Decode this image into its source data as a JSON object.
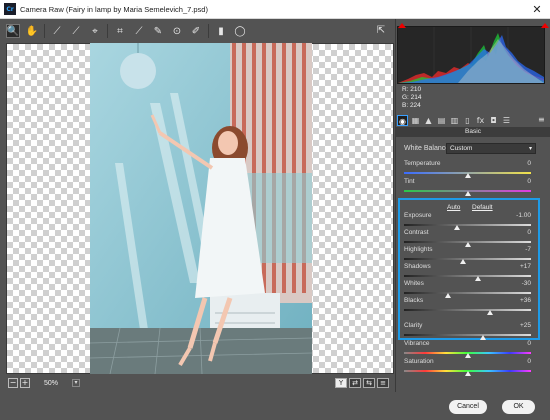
{
  "window": {
    "title": "Camera Raw (Fairy in lamp by Maria Semelevich_7.psd)",
    "app_badge": "Cr",
    "close_glyph": "✕"
  },
  "toolbar": {
    "tools": [
      {
        "name": "zoom-tool-icon",
        "glyph": "🔍"
      },
      {
        "name": "hand-tool-icon",
        "glyph": "✋"
      },
      {
        "name": "white-balance-tool-icon",
        "glyph": "⟋"
      },
      {
        "name": "color-sampler-tool-icon",
        "glyph": "⟋"
      },
      {
        "name": "targeted-adjustment-tool-icon",
        "glyph": "⌖"
      },
      {
        "name": "crop-tool-icon",
        "glyph": "⌗"
      },
      {
        "name": "straighten-tool-icon",
        "glyph": "⟋"
      },
      {
        "name": "spot-removal-tool-icon",
        "glyph": "✎"
      },
      {
        "name": "red-eye-tool-icon",
        "glyph": "⊙"
      },
      {
        "name": "adjustment-brush-icon",
        "glyph": "✐"
      },
      {
        "name": "graduated-filter-icon",
        "glyph": "▮"
      },
      {
        "name": "radial-filter-icon",
        "glyph": "◯"
      }
    ],
    "export_glyph": "⇱"
  },
  "status": {
    "zoom_minus": "−",
    "zoom_plus": "+",
    "zoom": "50%",
    "zoom_caret": "▾",
    "view_buttons": [
      "Y",
      "⇄",
      "⇆",
      "≡"
    ]
  },
  "histogram": {
    "r_label": "R: 210",
    "g_label": "G: 214",
    "b_label": "B: 224"
  },
  "panel_tabs": {
    "tabs": [
      {
        "name": "basic-tab-icon",
        "glyph": "◉"
      },
      {
        "name": "tone-curve-tab-icon",
        "glyph": "▦"
      },
      {
        "name": "detail-tab-icon",
        "glyph": "▲"
      },
      {
        "name": "hsl-tab-icon",
        "glyph": "▤"
      },
      {
        "name": "split-toning-tab-icon",
        "glyph": "▥"
      },
      {
        "name": "lens-corrections-tab-icon",
        "glyph": "▯"
      },
      {
        "name": "effects-tab-icon",
        "glyph": "fx"
      },
      {
        "name": "camera-calibration-tab-icon",
        "glyph": "◘"
      },
      {
        "name": "presets-tab-icon",
        "glyph": "☰"
      }
    ],
    "menu_glyph": "≡"
  },
  "basic": {
    "header": "Basic",
    "white_balance_label": "White Balance:",
    "white_balance_value": "Custom",
    "auto_link": "Auto",
    "default_link": "Default",
    "sliders": [
      {
        "label": "Temperature",
        "value": "0",
        "level": 0.5,
        "gradient": "temp"
      },
      {
        "label": "Tint",
        "value": "0",
        "level": 0.5,
        "gradient": "tint"
      },
      {
        "label": "Exposure",
        "value": "-1.00",
        "level": 0.42,
        "gradient": "gray"
      },
      {
        "label": "Contrast",
        "value": "0",
        "level": 0.5,
        "gradient": "gray"
      },
      {
        "label": "Highlights",
        "value": "-7",
        "level": 0.465,
        "gradient": "gray"
      },
      {
        "label": "Shadows",
        "value": "+17",
        "level": 0.585,
        "gradient": "gray"
      },
      {
        "label": "Whites",
        "value": "-30",
        "level": 0.35,
        "gradient": "gray"
      },
      {
        "label": "Blacks",
        "value": "+36",
        "level": 0.68,
        "gradient": "gray"
      },
      {
        "label": "Clarity",
        "value": "+25",
        "level": 0.625,
        "gradient": "gray"
      },
      {
        "label": "Vibrance",
        "value": "0",
        "level": 0.5,
        "gradient": "vib"
      },
      {
        "label": "Saturation",
        "value": "0",
        "level": 0.5,
        "gradient": "sat"
      }
    ]
  },
  "footer": {
    "cancel_label": "Cancel",
    "ok_label": "OK"
  }
}
